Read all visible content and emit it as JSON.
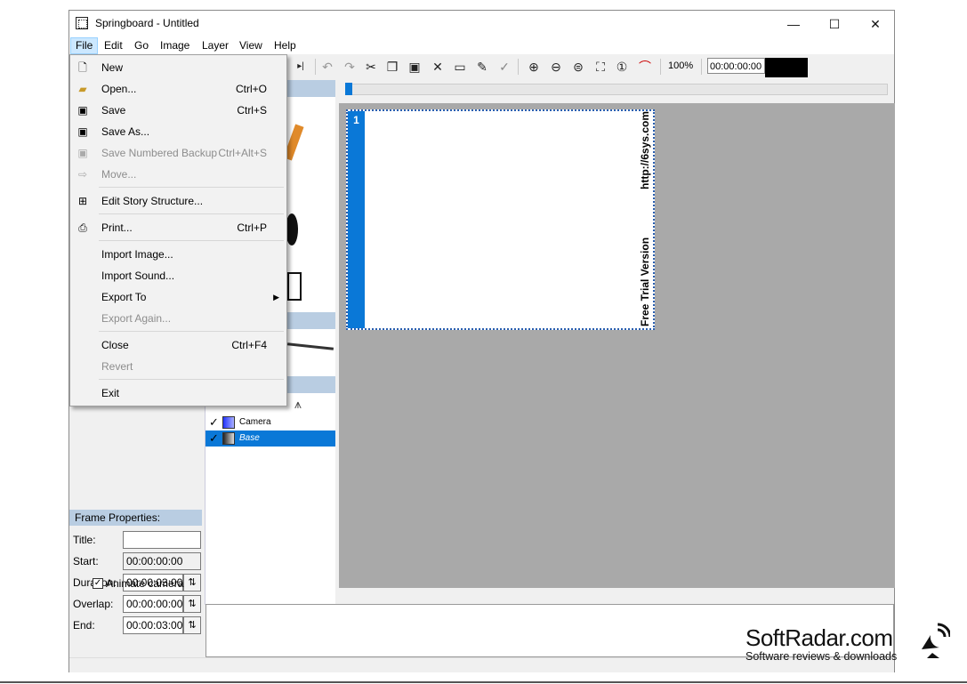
{
  "window": {
    "title": "Springboard - Untitled",
    "minimize": "—",
    "maximize": "☐",
    "close": "✕"
  },
  "menubar": [
    "File",
    "Edit",
    "Go",
    "Image",
    "Layer",
    "View",
    "Help"
  ],
  "toolbar": {
    "zoom": "100%",
    "timecode": "00:00:00:00"
  },
  "file_menu": {
    "items": [
      {
        "label": "New",
        "shortcut": "",
        "icon": "new-doc-icon",
        "disabled": false
      },
      {
        "label": "Open...",
        "shortcut": "Ctrl+O",
        "icon": "open-folder-icon",
        "disabled": false
      },
      {
        "label": "Save",
        "shortcut": "Ctrl+S",
        "icon": "save-icon",
        "disabled": false
      },
      {
        "label": "Save As...",
        "shortcut": "",
        "icon": "save-as-icon",
        "disabled": false
      },
      {
        "label": "Save Numbered Backup",
        "shortcut": "Ctrl+Alt+S",
        "icon": "backup-icon",
        "disabled": true
      },
      {
        "label": "Move...",
        "shortcut": "",
        "icon": "move-icon",
        "disabled": true
      },
      {
        "label": "Edit Story Structure...",
        "shortcut": "",
        "icon": "story-structure-icon",
        "disabled": false
      },
      {
        "label": "Print...",
        "shortcut": "Ctrl+P",
        "icon": "printer-icon",
        "disabled": false
      },
      {
        "label": "Import Image...",
        "shortcut": "",
        "icon": "",
        "disabled": false
      },
      {
        "label": "Import Sound...",
        "shortcut": "",
        "icon": "",
        "disabled": false
      },
      {
        "label": "Export To",
        "shortcut": "",
        "icon": "",
        "disabled": false,
        "submenu": true
      },
      {
        "label": "Export Again...",
        "shortcut": "",
        "icon": "",
        "disabled": true
      },
      {
        "label": "Close",
        "shortcut": "Ctrl+F4",
        "icon": "",
        "disabled": false
      },
      {
        "label": "Revert",
        "shortcut": "",
        "icon": "",
        "disabled": true
      },
      {
        "label": "Exit",
        "shortcut": "",
        "icon": "",
        "disabled": false
      }
    ]
  },
  "frame_properties": {
    "header": "Frame Properties:",
    "title_label": "Title:",
    "title_value": "",
    "start_label": "Start:",
    "start_value": "00:00:00:00",
    "duration_label": "Duration:",
    "duration_value": "00:00:03:00",
    "overlap_label": "Overlap:",
    "overlap_value": "00:00:00:00",
    "end_label": "End:",
    "end_value": "00:00:03:00",
    "animate_camera_label": "Animate camera",
    "animate_camera_checked": true
  },
  "layers": [
    {
      "name": "Camera",
      "checked": true,
      "selected": false
    },
    {
      "name": "Base",
      "checked": true,
      "selected": true
    }
  ],
  "frame": {
    "number": "1",
    "url_text": "http://6sys.com",
    "trial_text": "Free Trial Version"
  },
  "watermark": {
    "title": "SoftRadar.com",
    "subtitle": "Software reviews & downloads"
  },
  "colors": {
    "accent": "#0a78d7",
    "panel_header": "#b9cde2",
    "canvas_bg": "#a9a9a9"
  }
}
